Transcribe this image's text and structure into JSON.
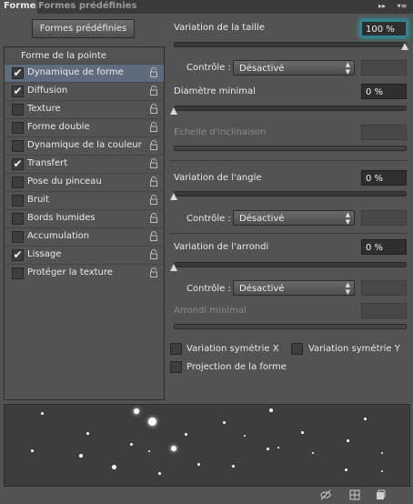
{
  "tabs": [
    {
      "label": "Forme"
    },
    {
      "label": "Formes prédéfinies"
    }
  ],
  "header": {
    "preset_button": "Formes prédéfinies"
  },
  "list": {
    "header": "Forme de la pointe",
    "items": [
      {
        "label": "Dynamique de forme",
        "checked": true,
        "selected": true
      },
      {
        "label": "Diffusion",
        "checked": true
      },
      {
        "label": "Texture",
        "checked": false
      },
      {
        "label": "Forme double",
        "checked": false
      },
      {
        "label": "Dynamique de la couleur",
        "checked": false
      },
      {
        "label": "Transfert",
        "checked": true
      },
      {
        "label": "Pose du pinceau",
        "checked": false
      },
      {
        "label": "Bruit",
        "checked": false
      },
      {
        "label": "Bords humides",
        "checked": false
      },
      {
        "label": "Accumulation",
        "checked": false
      },
      {
        "label": "Lissage",
        "checked": true
      },
      {
        "label": "Protéger la texture",
        "checked": false
      }
    ]
  },
  "settings": {
    "size_jitter": {
      "label": "Variation de la taille",
      "value": "100 %",
      "level": 1.0
    },
    "control1": {
      "label": "Contrôle :",
      "value": "Désactivé"
    },
    "min_diameter": {
      "label": "Diamètre minimal",
      "value": "0 %",
      "level": 0
    },
    "tilt_scale": {
      "label": "Echelle d'inclinaison"
    },
    "angle_jitter": {
      "label": "Variation de l'angle",
      "value": "0 %",
      "level": 0
    },
    "control2": {
      "label": "Contrôle :",
      "value": "Désactivé"
    },
    "roundness_jitter": {
      "label": "Variation de l'arrondi",
      "value": "0 %",
      "level": 0
    },
    "control3": {
      "label": "Contrôle :",
      "value": "Désactivé"
    },
    "min_roundness": {
      "label": "Arrondi minimal"
    },
    "flip_x": {
      "label": "Variation symétrie X",
      "checked": false
    },
    "flip_y": {
      "label": "Variation symétrie Y",
      "checked": false
    },
    "projection": {
      "label": "Projection de la forme",
      "checked": false
    }
  },
  "glyphs": {
    "check": "✔",
    "arrows": "▲▼",
    "collapse": "▸▸",
    "menu": "▾≡"
  },
  "colors": {
    "accent_glow": "#2a9ea8",
    "selection": "#5f6c7e"
  }
}
